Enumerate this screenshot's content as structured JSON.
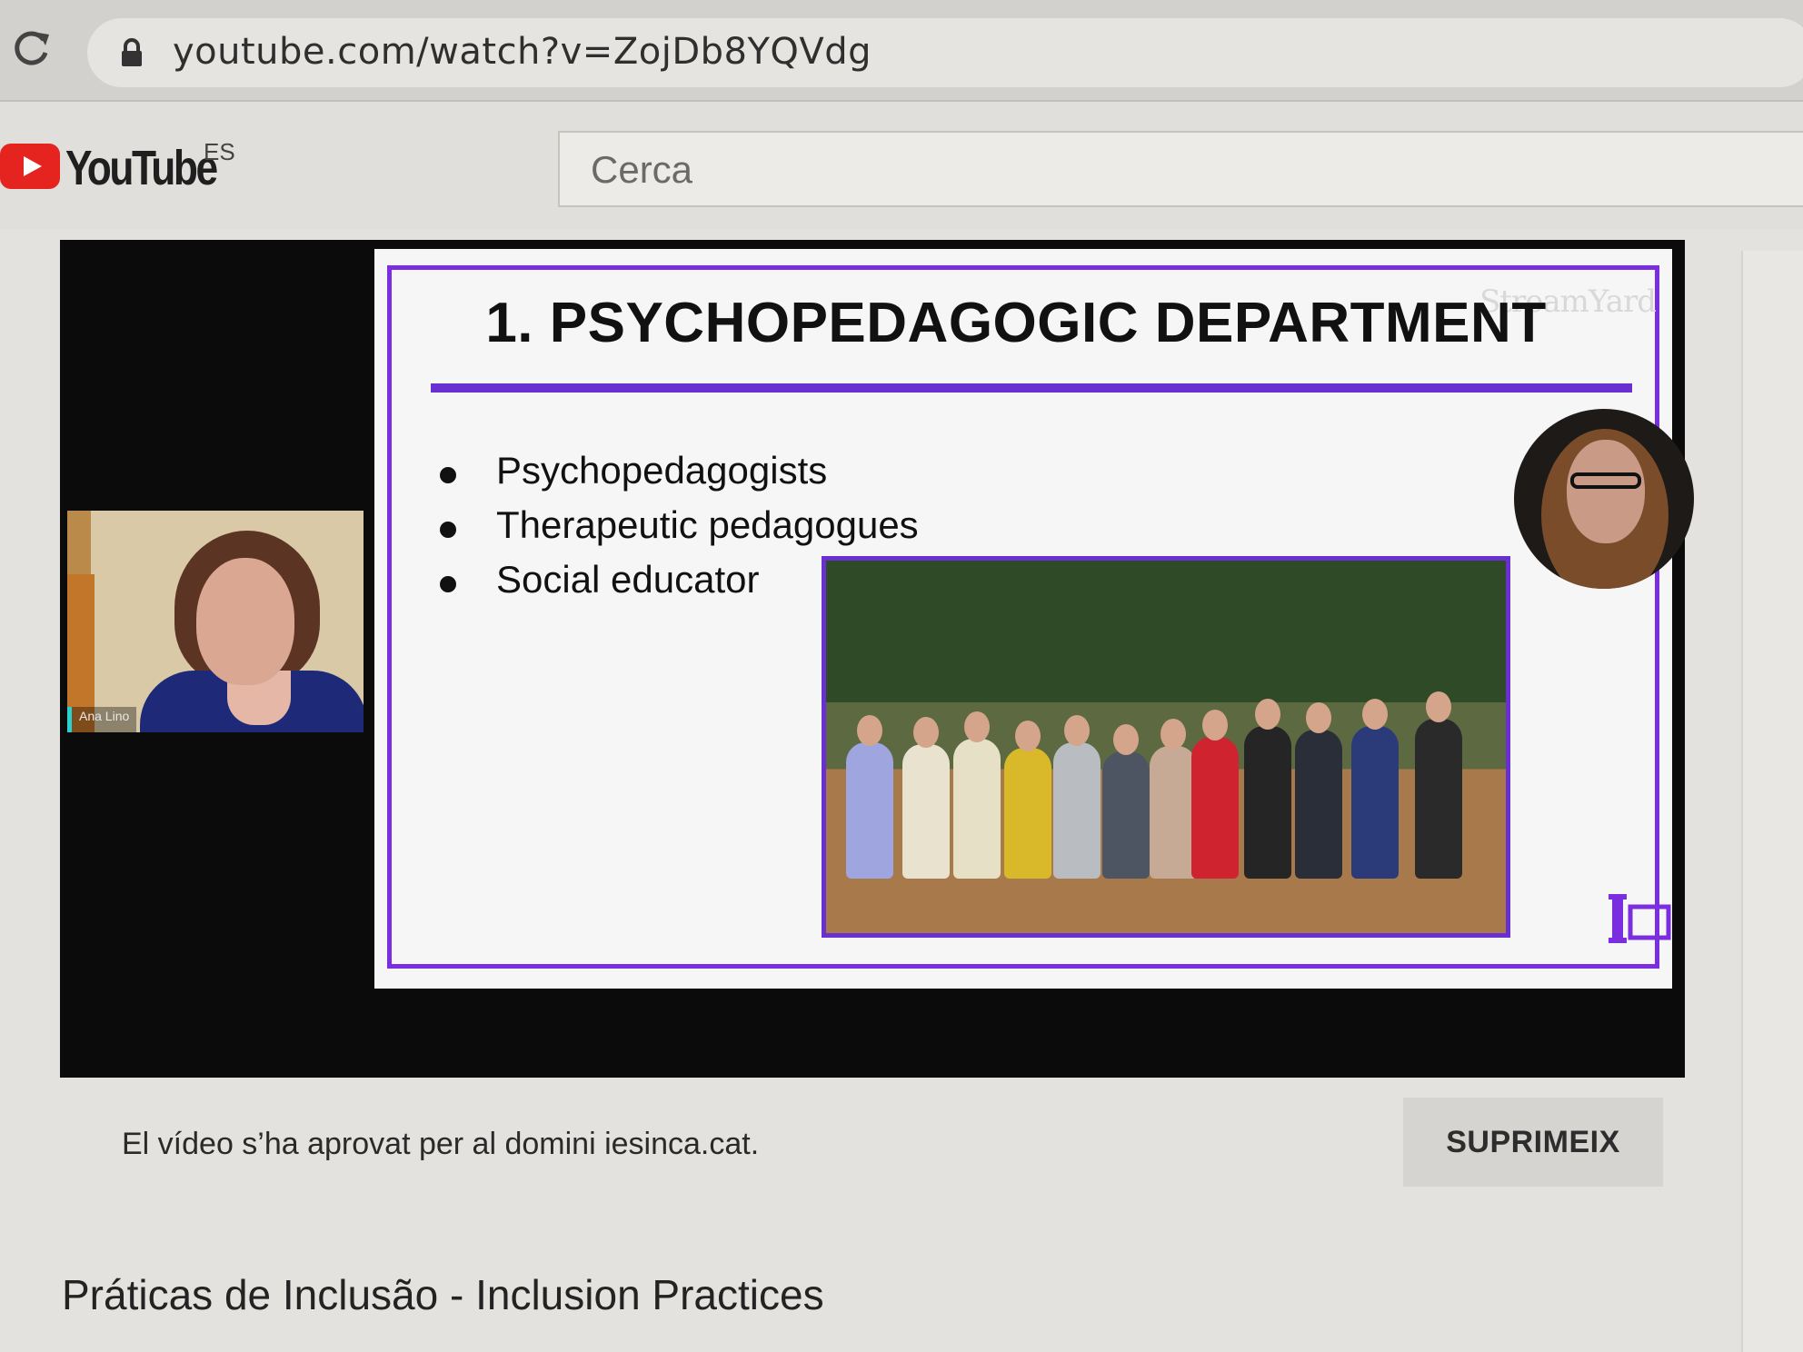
{
  "browser": {
    "url": "youtube.com/watch?v=ZojDb8YQVdg"
  },
  "youtube": {
    "logo_text": "YouTube",
    "region": "ES",
    "search_placeholder": "Cerca"
  },
  "player": {
    "webcam_name": "Ana Lino",
    "watermark": "StreamYard",
    "slide": {
      "title": "1. PSYCHOPEDAGOGIC DEPARTMENT",
      "bullets": [
        "Psychopedagogists",
        "Therapeutic pedagogues",
        "Social educator"
      ]
    },
    "accent_color": "#7a2ee0"
  },
  "notice": {
    "text": "El vídeo s’ha aprovat per al domini iesinca.cat.",
    "delete_label": "SUPRIMEIX"
  },
  "video": {
    "title": "Práticas de Inclusão - Inclusion Practices"
  },
  "icons": [
    "reload-icon",
    "lock-icon",
    "youtube-play-icon"
  ]
}
